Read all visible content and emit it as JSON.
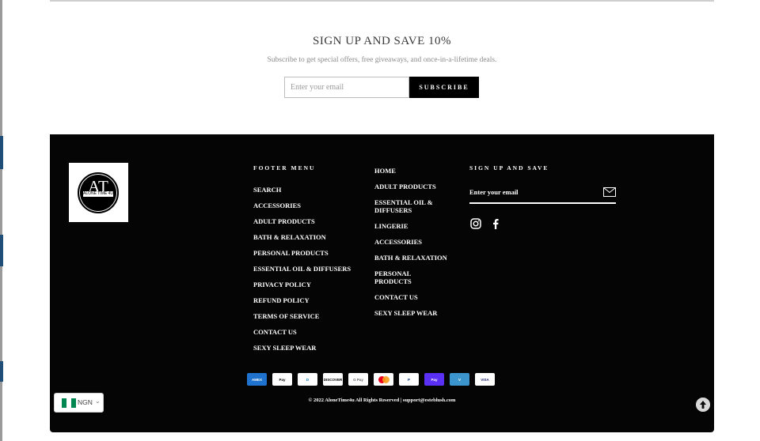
{
  "newsletter": {
    "title": "SIGN UP AND SAVE 10%",
    "subtitle": "Subscribe to get special offers, free giveaways, and once-in-a-lifetime deals.",
    "email_placeholder": "Enter your email",
    "subscribe_label": "SUBSCRIBE"
  },
  "footer": {
    "logo": {
      "letters": "AT",
      "banner": "ALONE TIME 4U"
    },
    "menu_heading": "FOOTER MENU",
    "menu_items": [
      "SEARCH",
      "ACCESSORIES",
      "ADULT PRODUCTS",
      "BATH & RELAXATION",
      "PERSONAL PRODUCTS",
      "ESSENTIAL OIL & DIFFUSERS",
      "PRIVACY POLICY",
      "REFUND POLICY",
      "TERMS OF SERVICE",
      "CONTACT US",
      "SEXY SLEEP WEAR"
    ],
    "menu2_items": [
      "HOME",
      "ADULT PRODUCTS",
      "ESSENTIAL OIL & DIFFUSERS",
      "LINGERIE",
      "ACCESSORIES",
      "BATH & RELAXATION",
      "PERSONAL PRODUCTS",
      "CONTACT US",
      "SEXY SLEEP WEAR"
    ],
    "signup_heading": "SIGN UP AND SAVE",
    "email_placeholder": "Enter your email",
    "social": [
      "instagram-icon",
      "facebook-icon"
    ],
    "payments": [
      {
        "name": "AMEX",
        "bg": "#1f72cd",
        "fg": "#ffffff"
      },
      {
        "name": "Pay",
        "bg": "#ffffff",
        "fg": "#000000"
      },
      {
        "name": "D",
        "bg": "#ffffff",
        "fg": "#0079be"
      },
      {
        "name": "DISCOVER",
        "bg": "#ffffff",
        "fg": "#000000"
      },
      {
        "name": "G Pay",
        "bg": "#ffffff",
        "fg": "#5f6368"
      },
      {
        "name": "",
        "bg": "#ffffff",
        "fg": "#eb001b"
      },
      {
        "name": "P",
        "bg": "#ffffff",
        "fg": "#003087"
      },
      {
        "name": "Pay",
        "bg": "#5a31f4",
        "fg": "#ffffff"
      },
      {
        "name": "V",
        "bg": "#3d95ce",
        "fg": "#ffffff"
      },
      {
        "name": "VISA",
        "bg": "#ffffff",
        "fg": "#1a1f71"
      }
    ],
    "copyright": "© 2022 AloneTime4u All Rights Reserved | support@esteblush.com"
  },
  "currency": {
    "code": "NGN",
    "chevron": "⌄"
  },
  "colors": {
    "footer_bg": "#050505",
    "accent": "#000000"
  }
}
